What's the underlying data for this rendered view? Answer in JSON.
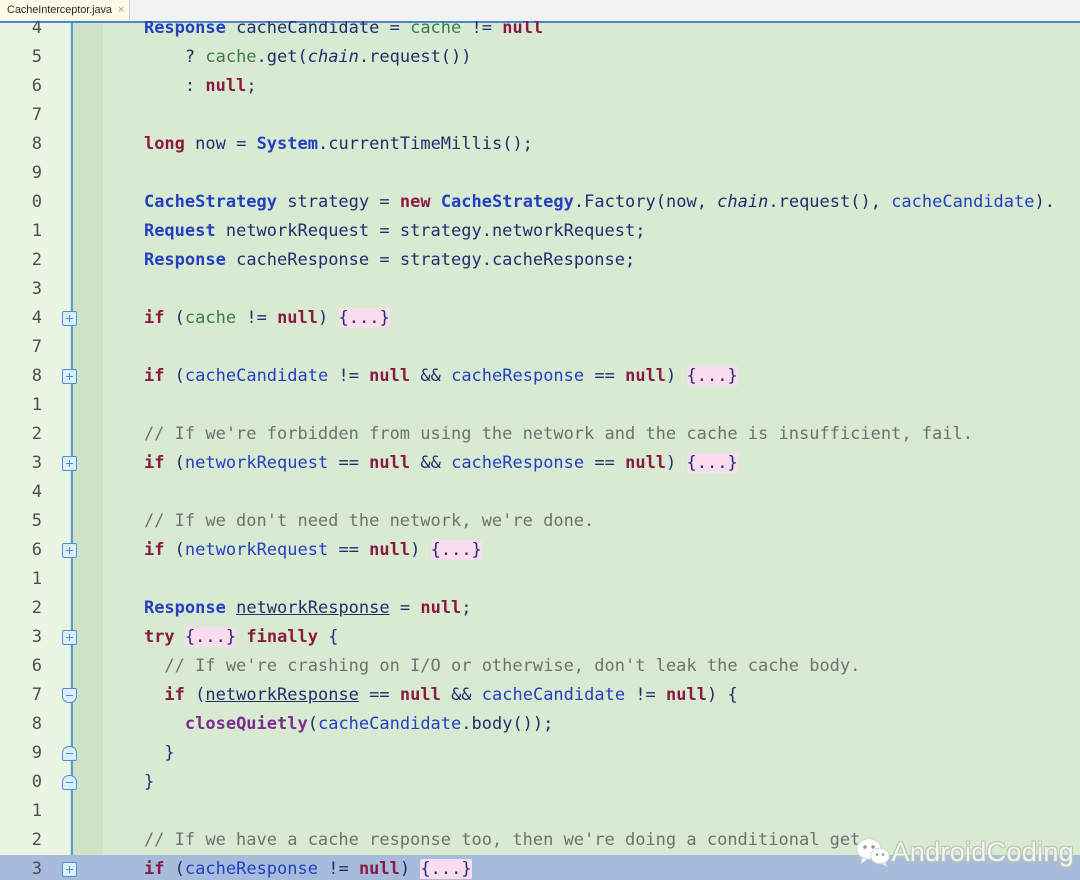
{
  "window": {
    "title": "CacheInterceptor.java"
  },
  "tabbar": {
    "tabs": [
      {
        "label": "CacheInterceptor.java",
        "close_icon": "close-icon",
        "close_glyph": "×",
        "active": true
      }
    ]
  },
  "editor": {
    "language": "java",
    "colors": {
      "background": "#d9ead3",
      "gutter_background": "#eaf5e4",
      "fold_strip_background": "#cfe3c6",
      "fold_line": "#5b9bd5",
      "selection_line": "#a7bcdc",
      "folded_placeholder_background": "#fadcef",
      "keyword": "#8b1a42",
      "type": "#2440c0",
      "field": "#3a7d44",
      "comment": "#707070",
      "static_method": "#7b2d8e",
      "identifier": "#1f2f6e"
    },
    "folded_placeholder": "{...}",
    "caret_line": 93,
    "lines": [
      {
        "number": "4",
        "fold": null,
        "selected": false,
        "tokens": [
          {
            "t": "    ",
            "c": "id"
          },
          {
            "t": "Response",
            "c": "type"
          },
          {
            "t": " cacheCandidate = ",
            "c": "id"
          },
          {
            "t": "cache",
            "c": "fld"
          },
          {
            "t": " != ",
            "c": "id"
          },
          {
            "t": "null",
            "c": "kw"
          }
        ]
      },
      {
        "number": "5",
        "fold": null,
        "selected": false,
        "tokens": [
          {
            "t": "        ? ",
            "c": "id"
          },
          {
            "t": "cache",
            "c": "fld"
          },
          {
            "t": ".get(",
            "c": "id"
          },
          {
            "t": "chain",
            "c": "ital"
          },
          {
            "t": ".request())",
            "c": "id"
          }
        ]
      },
      {
        "number": "6",
        "fold": null,
        "selected": false,
        "tokens": [
          {
            "t": "        : ",
            "c": "id"
          },
          {
            "t": "null",
            "c": "kw"
          },
          {
            "t": ";",
            "c": "id"
          }
        ]
      },
      {
        "number": "7",
        "fold": null,
        "selected": false,
        "tokens": []
      },
      {
        "number": "8",
        "fold": null,
        "selected": false,
        "tokens": [
          {
            "t": "    ",
            "c": "id"
          },
          {
            "t": "long",
            "c": "kw"
          },
          {
            "t": " now = ",
            "c": "id"
          },
          {
            "t": "System",
            "c": "type"
          },
          {
            "t": ".currentTimeMillis();",
            "c": "id"
          }
        ]
      },
      {
        "number": "9",
        "fold": null,
        "selected": false,
        "tokens": []
      },
      {
        "number": "0",
        "fold": null,
        "selected": false,
        "tokens": [
          {
            "t": "    ",
            "c": "id"
          },
          {
            "t": "CacheStrategy",
            "c": "type"
          },
          {
            "t": " strategy = ",
            "c": "id"
          },
          {
            "t": "new",
            "c": "kw"
          },
          {
            "t": " ",
            "c": "id"
          },
          {
            "t": "CacheStrategy",
            "c": "type"
          },
          {
            "t": ".Factory(now, ",
            "c": "id"
          },
          {
            "t": "chain",
            "c": "ital"
          },
          {
            "t": ".request(), ",
            "c": "id"
          },
          {
            "t": "cacheCandidate",
            "c": "var"
          },
          {
            "t": ").",
            "c": "id"
          }
        ]
      },
      {
        "number": "1",
        "fold": null,
        "selected": false,
        "tokens": [
          {
            "t": "    ",
            "c": "id"
          },
          {
            "t": "Request",
            "c": "type"
          },
          {
            "t": " networkRequest = strategy.networkRequest;",
            "c": "id"
          }
        ]
      },
      {
        "number": "2",
        "fold": null,
        "selected": false,
        "tokens": [
          {
            "t": "    ",
            "c": "id"
          },
          {
            "t": "Response",
            "c": "type"
          },
          {
            "t": " cacheResponse = strategy.cacheResponse;",
            "c": "id"
          }
        ]
      },
      {
        "number": "3",
        "fold": null,
        "selected": false,
        "tokens": []
      },
      {
        "number": "4",
        "fold": "plus",
        "selected": false,
        "tokens": [
          {
            "t": "    ",
            "c": "id"
          },
          {
            "t": "if",
            "c": "kw"
          },
          {
            "t": " (",
            "c": "id"
          },
          {
            "t": "cache",
            "c": "fld"
          },
          {
            "t": " != ",
            "c": "id"
          },
          {
            "t": "null",
            "c": "kw"
          },
          {
            "t": ") ",
            "c": "id"
          },
          {
            "t": "{...}",
            "c": "fold-txt"
          }
        ]
      },
      {
        "number": "7",
        "fold": null,
        "selected": false,
        "tokens": []
      },
      {
        "number": "8",
        "fold": "plus",
        "selected": false,
        "tokens": [
          {
            "t": "    ",
            "c": "id"
          },
          {
            "t": "if",
            "c": "kw"
          },
          {
            "t": " (",
            "c": "id"
          },
          {
            "t": "cacheCandidate",
            "c": "var"
          },
          {
            "t": " != ",
            "c": "id"
          },
          {
            "t": "null",
            "c": "kw"
          },
          {
            "t": " && ",
            "c": "id"
          },
          {
            "t": "cacheResponse",
            "c": "var"
          },
          {
            "t": " == ",
            "c": "id"
          },
          {
            "t": "null",
            "c": "kw"
          },
          {
            "t": ") ",
            "c": "id"
          },
          {
            "t": "{...}",
            "c": "fold-txt"
          }
        ]
      },
      {
        "number": "1",
        "fold": null,
        "selected": false,
        "tokens": []
      },
      {
        "number": "2",
        "fold": null,
        "selected": false,
        "tokens": [
          {
            "t": "    // If we're forbidden from using the network and the cache is insufficient, fail.",
            "c": "cmt"
          }
        ]
      },
      {
        "number": "3",
        "fold": "plus",
        "selected": false,
        "tokens": [
          {
            "t": "    ",
            "c": "id"
          },
          {
            "t": "if",
            "c": "kw"
          },
          {
            "t": " (",
            "c": "id"
          },
          {
            "t": "networkRequest",
            "c": "var"
          },
          {
            "t": " == ",
            "c": "id"
          },
          {
            "t": "null",
            "c": "kw"
          },
          {
            "t": " && ",
            "c": "id"
          },
          {
            "t": "cacheResponse",
            "c": "var"
          },
          {
            "t": " == ",
            "c": "id"
          },
          {
            "t": "null",
            "c": "kw"
          },
          {
            "t": ") ",
            "c": "id"
          },
          {
            "t": "{...}",
            "c": "fold-txt"
          }
        ]
      },
      {
        "number": "4",
        "fold": null,
        "selected": false,
        "tokens": []
      },
      {
        "number": "5",
        "fold": null,
        "selected": false,
        "tokens": [
          {
            "t": "    // If we don't need the network, we're done.",
            "c": "cmt"
          }
        ]
      },
      {
        "number": "6",
        "fold": "plus",
        "selected": false,
        "tokens": [
          {
            "t": "    ",
            "c": "id"
          },
          {
            "t": "if",
            "c": "kw"
          },
          {
            "t": " (",
            "c": "id"
          },
          {
            "t": "networkRequest",
            "c": "var"
          },
          {
            "t": " == ",
            "c": "id"
          },
          {
            "t": "null",
            "c": "kw"
          },
          {
            "t": ") ",
            "c": "id"
          },
          {
            "t": "{...}",
            "c": "fold-txt"
          }
        ]
      },
      {
        "number": "1",
        "fold": null,
        "selected": false,
        "tokens": []
      },
      {
        "number": "2",
        "fold": null,
        "selected": false,
        "tokens": [
          {
            "t": "    ",
            "c": "id"
          },
          {
            "t": "Response",
            "c": "type"
          },
          {
            "t": " ",
            "c": "id"
          },
          {
            "t": "networkResponse",
            "c": "id und"
          },
          {
            "t": " = ",
            "c": "id"
          },
          {
            "t": "null",
            "c": "kw"
          },
          {
            "t": ";",
            "c": "id"
          }
        ]
      },
      {
        "number": "3",
        "fold": "plus",
        "selected": false,
        "tokens": [
          {
            "t": "    ",
            "c": "id"
          },
          {
            "t": "try",
            "c": "kw"
          },
          {
            "t": " ",
            "c": "id"
          },
          {
            "t": "{...}",
            "c": "fold-txt"
          },
          {
            "t": " ",
            "c": "id"
          },
          {
            "t": "finally",
            "c": "kw"
          },
          {
            "t": " {",
            "c": "id"
          }
        ]
      },
      {
        "number": "6",
        "fold": null,
        "selected": false,
        "tokens": [
          {
            "t": "      // If we're crashing on I/O or otherwise, don't leak the cache body.",
            "c": "cmt"
          }
        ]
      },
      {
        "number": "7",
        "fold": "start",
        "selected": false,
        "tokens": [
          {
            "t": "      ",
            "c": "id"
          },
          {
            "t": "if",
            "c": "kw"
          },
          {
            "t": " (",
            "c": "id"
          },
          {
            "t": "networkResponse",
            "c": "id und"
          },
          {
            "t": " == ",
            "c": "id"
          },
          {
            "t": "null",
            "c": "kw"
          },
          {
            "t": " && ",
            "c": "id"
          },
          {
            "t": "cacheCandidate",
            "c": "var"
          },
          {
            "t": " != ",
            "c": "id"
          },
          {
            "t": "null",
            "c": "kw"
          },
          {
            "t": ") {",
            "c": "id"
          }
        ]
      },
      {
        "number": "8",
        "fold": null,
        "selected": false,
        "tokens": [
          {
            "t": "        ",
            "c": "id"
          },
          {
            "t": "closeQuietly",
            "c": "stat"
          },
          {
            "t": "(",
            "c": "id"
          },
          {
            "t": "cacheCandidate",
            "c": "var"
          },
          {
            "t": ".body());",
            "c": "id"
          }
        ]
      },
      {
        "number": "9",
        "fold": "end",
        "selected": false,
        "tokens": [
          {
            "t": "      }",
            "c": "id"
          }
        ]
      },
      {
        "number": "0",
        "fold": "end",
        "selected": false,
        "tokens": [
          {
            "t": "    }",
            "c": "id"
          }
        ]
      },
      {
        "number": "1",
        "fold": null,
        "selected": false,
        "tokens": []
      },
      {
        "number": "2",
        "fold": null,
        "selected": false,
        "tokens": [
          {
            "t": "    // If we have a cache response too, then we're doing a conditional get.",
            "c": "cmt"
          }
        ]
      },
      {
        "number": "3",
        "fold": "plus",
        "selected": true,
        "caret_before_fold": true,
        "tokens": [
          {
            "t": "    ",
            "c": "id"
          },
          {
            "t": "if",
            "c": "kw"
          },
          {
            "t": " (",
            "c": "id"
          },
          {
            "t": "cacheResponse",
            "c": "var"
          },
          {
            "t": " != ",
            "c": "id"
          },
          {
            "t": "null",
            "c": "kw"
          },
          {
            "t": ") ",
            "c": "id"
          },
          {
            "t": "CARET",
            "c": "caret"
          },
          {
            "t": "{...}",
            "c": "fold-txt"
          }
        ]
      }
    ]
  },
  "watermark": {
    "logo_icon": "wechat-logo-icon",
    "text": "AndroidCoding"
  }
}
